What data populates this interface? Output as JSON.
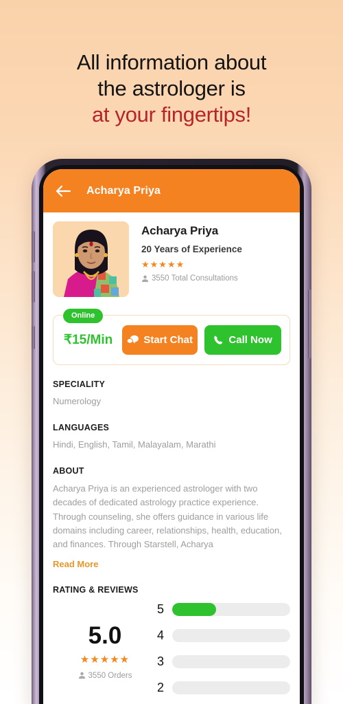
{
  "promo": {
    "line1": "All information about",
    "line2": "the astrologer is",
    "line3": "at your fingertips!",
    "accent_color": "#b7252a"
  },
  "appbar": {
    "back_icon": "arrow-left-icon",
    "title": "Acharya Priya",
    "bg_color": "#f58220"
  },
  "profile": {
    "avatar_alt": "astrologer-photo",
    "name": "Acharya Priya",
    "experience": "20 Years of Experience",
    "stars": "★★★★★",
    "star_count": 5,
    "consultations": "3550 Total Consultations",
    "person_icon": "person-icon"
  },
  "action": {
    "online_label": "Online",
    "price": "₹15/Min",
    "chat_label": "Start Chat",
    "chat_icon": "chat-bubble-icon",
    "call_label": "Call Now",
    "call_icon": "phone-icon",
    "chat_color": "#f58220",
    "call_color": "#2fc22f",
    "price_color": "#2fc22f"
  },
  "speciality": {
    "title": "SPECIALITY",
    "value": "Numerology"
  },
  "languages": {
    "title": "LANGUAGES",
    "value": "Hindi, English, Tamil, Malayalam, Marathi"
  },
  "about": {
    "title": "ABOUT",
    "text": "Acharya Priya is an experienced astrologer with two decades of dedicated astrology practice experience. Through counseling, she offers guidance in various life domains including career, relationships, health, education, and finances. Through Starstell, Acharya",
    "read_more": "Read More",
    "read_more_color": "#e8972a"
  },
  "ratings": {
    "title": "RATING & REVIEWS",
    "score": "5.0",
    "stars": "★★★★★",
    "orders": "3550 Orders",
    "person_icon": "person-icon",
    "bars": [
      {
        "label": "5",
        "percent": 37
      },
      {
        "label": "4",
        "percent": 0
      },
      {
        "label": "3",
        "percent": 0
      },
      {
        "label": "2",
        "percent": 0
      }
    ]
  }
}
